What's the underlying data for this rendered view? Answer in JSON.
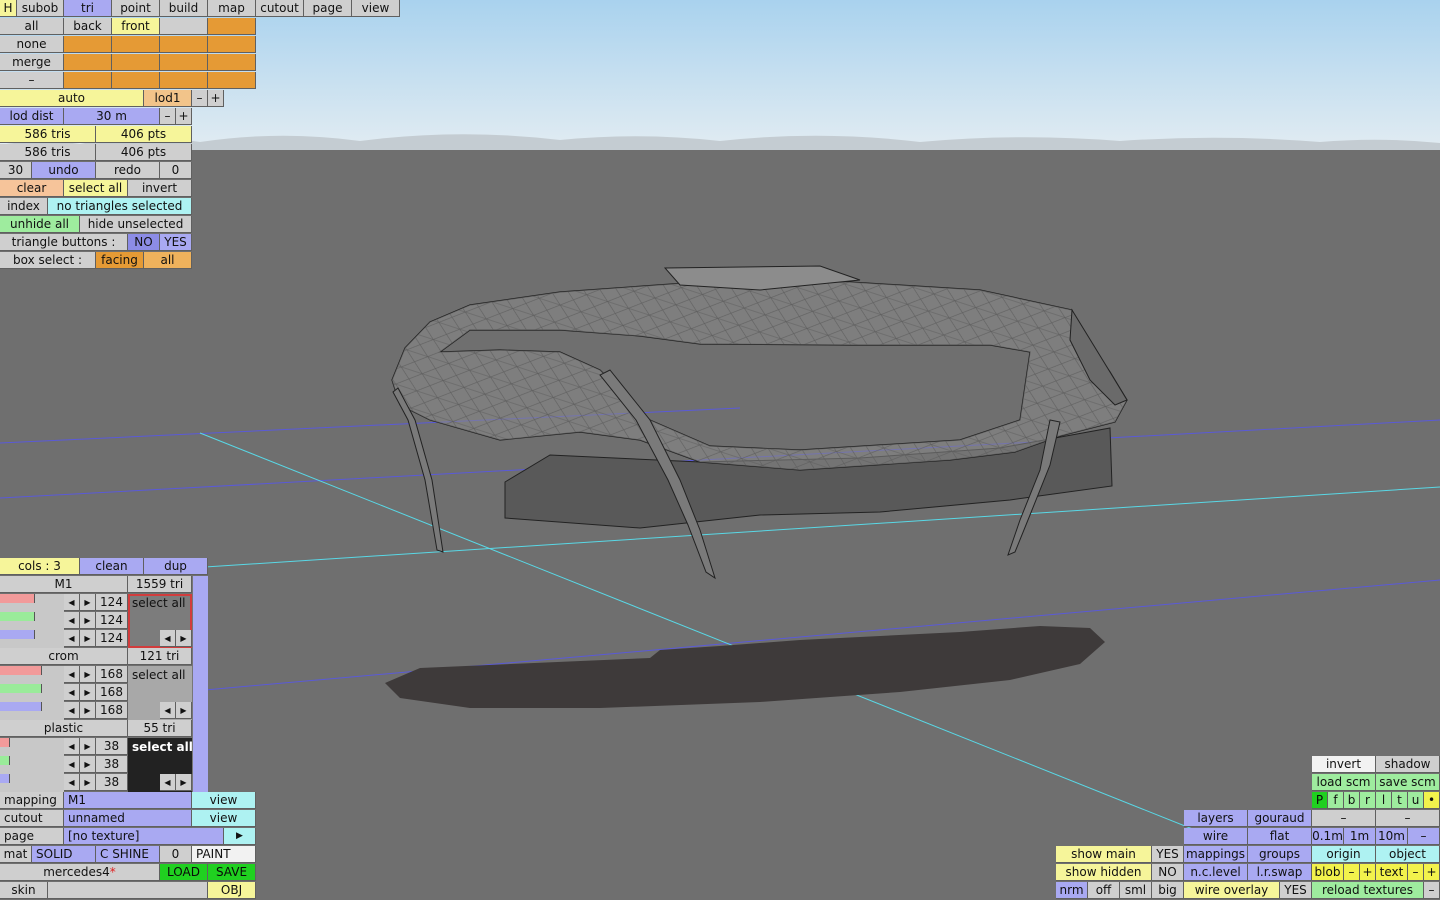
{
  "menu_tabs": [
    "H",
    "subob",
    "tri",
    "point",
    "build",
    "map",
    "cutout",
    "page",
    "view"
  ],
  "subob_rows": [
    "all",
    "none",
    "merge",
    "–"
  ],
  "view_buttons": [
    "back",
    "front"
  ],
  "lod": {
    "auto": "auto",
    "lod": "lod1",
    "minus": "–",
    "plus": "+",
    "dist_label": "lod dist",
    "dist_value": "30 m"
  },
  "tri_stats": {
    "tris1": "586 tris",
    "pts1": "406 pts",
    "tris2": "586 tris",
    "pts2": "406 pts"
  },
  "undo_row": {
    "count": "30",
    "undo": "undo",
    "redo": "redo",
    "redo_count": "0"
  },
  "selection": {
    "clear": "clear",
    "select_all": "select all",
    "invert": "invert",
    "index": "index",
    "status": "no triangles selected",
    "unhide_all": "unhide all",
    "hide_unselected": "hide unselected",
    "tri_buttons_label": "triangle buttons :",
    "no": "NO",
    "yes": "YES",
    "box_select_label": "box select :",
    "facing": "facing",
    "all": "all"
  },
  "materials_header": {
    "cols": "cols : 3",
    "clean": "clean",
    "dup": "dup"
  },
  "materials": [
    {
      "name": "M1",
      "tris": "1559 tri",
      "values": [
        "124",
        "124",
        "124"
      ],
      "select_all": "select all"
    },
    {
      "name": "crom",
      "tris": "121 tri",
      "values": [
        "168",
        "168",
        "168"
      ],
      "select_all": "select all"
    },
    {
      "name": "plastic",
      "tris": "55 tri",
      "values": [
        "38",
        "38",
        "38"
      ],
      "select_all": "select all"
    }
  ],
  "slider_levels": [
    [
      0.55,
      0.55,
      0.55
    ],
    [
      0.66,
      0.66,
      0.66
    ],
    [
      0.15,
      0.15,
      0.15
    ]
  ],
  "bottom_left": {
    "mapping": "mapping",
    "mapping_value": "M1",
    "view": "view",
    "cutout": "cutout",
    "cutout_value": "unnamed",
    "page": "page",
    "page_value": "[no texture]",
    "mat": "mat",
    "solid": "SOLID",
    "shine": "C SHINE",
    "shine_value": "0",
    "paint": "PAINT",
    "filename": "mercedes4",
    "modified_mark": "*",
    "load": "LOAD",
    "save": "SAVE",
    "skin": "skin",
    "obj": "OBJ"
  },
  "bottom_right": {
    "invert": "invert",
    "shadow": "shadow",
    "load_scm": "load scm",
    "save_scm": "save scm",
    "flags": [
      "P",
      "f",
      "b",
      "r",
      "l",
      "t",
      "u",
      "•"
    ],
    "dash": "–",
    "layers": "layers",
    "gouraud": "gouraud",
    "wire": "wire",
    "flat": "flat",
    "grid_01": "0.1m",
    "grid_1": "1m",
    "grid_10": "10m",
    "mappings": "mappings",
    "groups": "groups",
    "origin": "origin",
    "object": "object",
    "show_main": "show main",
    "show_main_value": "YES",
    "show_hidden": "show hidden",
    "show_hidden_value": "NO",
    "n_c_level": "n.c.level",
    "l_r_swap": "l.r.swap",
    "blob": "blob",
    "text": "text",
    "nrm": "nrm",
    "off": "off",
    "sml": "sml",
    "big": "big",
    "wire_overlay": "wire overlay",
    "wire_overlay_value": "YES",
    "reload_textures": "reload textures"
  },
  "colors": {
    "sky_top": "#b6d8ef",
    "sky_bottom": "#dfeaf2",
    "ground": "#6e6e6e",
    "accent_orange": "#e59a35",
    "accent_blue": "#a9a9f2",
    "highlight_green": "#20d020"
  }
}
